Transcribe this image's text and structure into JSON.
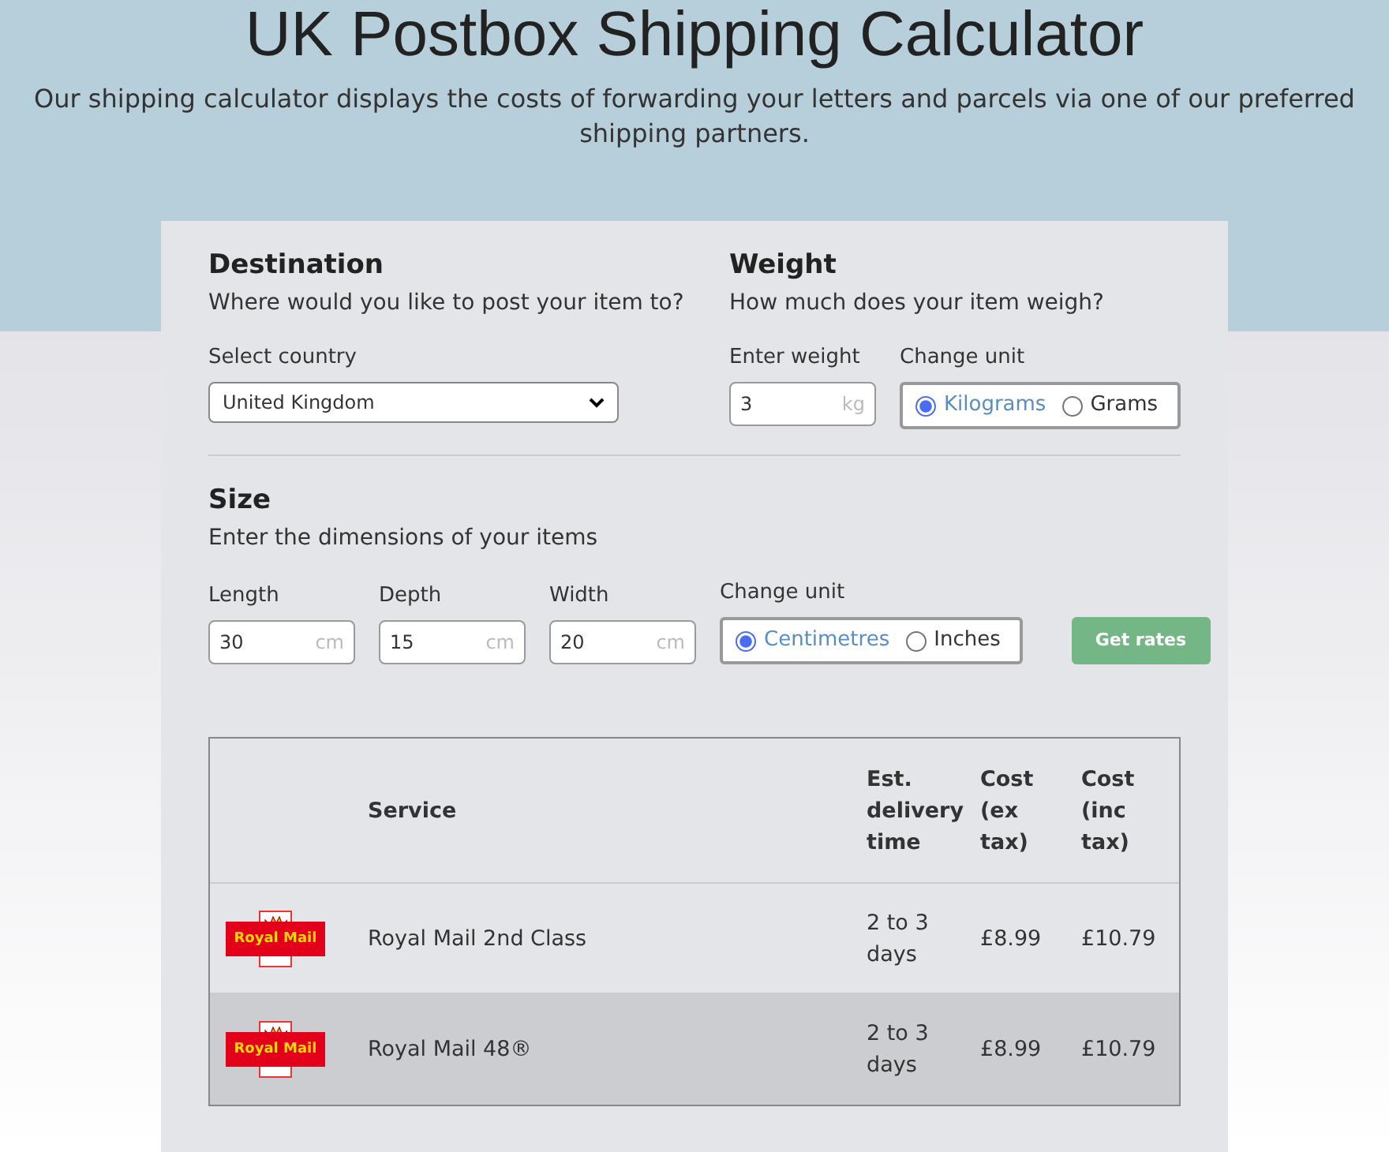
{
  "header": {
    "title": "UK Postbox Shipping Calculator",
    "subtitle": "Our shipping calculator displays the costs of forwarding your letters and parcels via one of our preferred shipping partners."
  },
  "destination": {
    "heading": "Destination",
    "prompt": "Where would you like to post your item to?",
    "label": "Select country",
    "value": "United Kingdom"
  },
  "weight": {
    "heading": "Weight",
    "prompt": "How much does your item weigh?",
    "label": "Enter weight",
    "value": "3",
    "unit": "kg",
    "unit_label": "Change unit",
    "units": [
      {
        "label": "Kilograms",
        "selected": true
      },
      {
        "label": "Grams",
        "selected": false
      }
    ]
  },
  "size": {
    "heading": "Size",
    "prompt": "Enter the dimensions of your items",
    "fields": [
      {
        "label": "Length",
        "value": "30",
        "unit": "cm"
      },
      {
        "label": "Depth",
        "value": "15",
        "unit": "cm"
      },
      {
        "label": "Width",
        "value": "20",
        "unit": "cm"
      }
    ],
    "unit_label": "Change unit",
    "units": [
      {
        "label": "Centimetres",
        "selected": true
      },
      {
        "label": "Inches",
        "selected": false
      }
    ],
    "button": "Get rates"
  },
  "table": {
    "columns": [
      "Service",
      "Est. delivery time",
      "Cost (ex tax)",
      "Cost (inc tax)"
    ],
    "rows": [
      {
        "logo_text": "Royal Mail",
        "service": "Royal Mail 2nd Class",
        "delivery": "2 to 3 days",
        "cost_ex": "£8.99",
        "cost_inc": "£10.79",
        "highlighted": false
      },
      {
        "logo_text": "Royal Mail",
        "service": "Royal Mail 48®",
        "delivery": "2 to 3 days",
        "cost_ex": "£8.99",
        "cost_inc": "£10.79",
        "highlighted": true
      }
    ]
  }
}
